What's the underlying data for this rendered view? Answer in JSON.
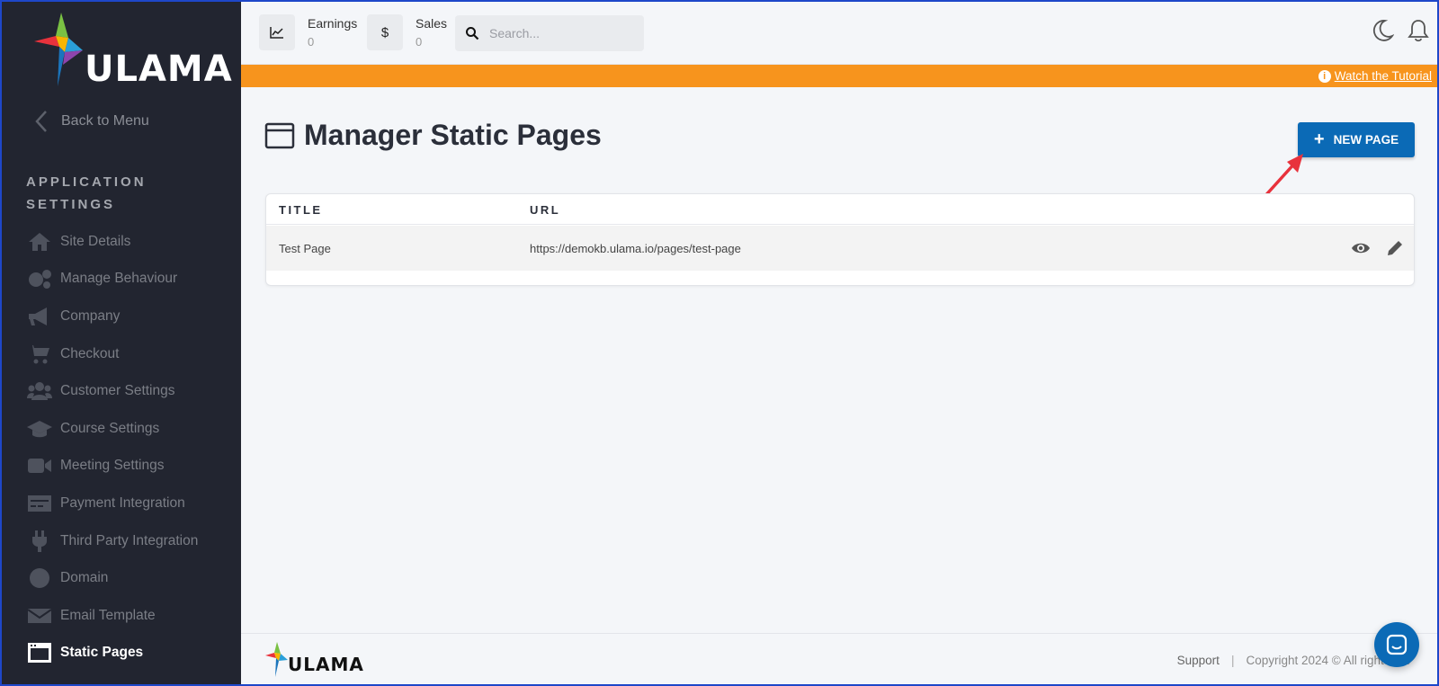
{
  "brand": {
    "name": "ULAMA"
  },
  "sidebar": {
    "back_label": "Back to Menu",
    "section_title": "APPLICATION SETTINGS",
    "items": [
      {
        "label": "Site Details",
        "icon": "home-icon"
      },
      {
        "label": "Manage Behaviour",
        "icon": "gears-icon"
      },
      {
        "label": "Company",
        "icon": "megaphone-icon"
      },
      {
        "label": "Checkout",
        "icon": "cart-icon"
      },
      {
        "label": "Customer Settings",
        "icon": "users-icon"
      },
      {
        "label": "Course Settings",
        "icon": "graduation-cap-icon"
      },
      {
        "label": "Meeting Settings",
        "icon": "video-camera-icon"
      },
      {
        "label": "Payment Integration",
        "icon": "credit-card-icon"
      },
      {
        "label": "Third Party Integration",
        "icon": "plug-icon"
      },
      {
        "label": "Domain",
        "icon": "globe-icon"
      },
      {
        "label": "Email Template",
        "icon": "envelope-icon"
      },
      {
        "label": "Static Pages",
        "icon": "window-icon",
        "active": true
      }
    ]
  },
  "topbar": {
    "earnings_label": "Earnings",
    "earnings_value": "0",
    "sales_label": "Sales",
    "sales_value": "0",
    "sales_icon": "$",
    "search_placeholder": "Search..."
  },
  "banner": {
    "link_label": "Watch the Tutorial",
    "info_glyph": "i"
  },
  "main": {
    "title": "Manager Static Pages",
    "new_button_label": "NEW PAGE",
    "new_button_glyph": "+",
    "table": {
      "columns": [
        "TITLE",
        "URL"
      ],
      "rows": [
        {
          "title": "Test Page",
          "url": "https://demokb.ulama.io/pages/test-page"
        }
      ]
    }
  },
  "footer": {
    "brand": "ULAMA",
    "support_label": "Support",
    "separator": "|",
    "copyright": "Copyright 2024 © All rights res"
  },
  "colors": {
    "sidebar_bg": "#222530",
    "banner": "#f7941d",
    "primary": "#0b6ab6",
    "annotation_arrow": "#e8323c"
  }
}
